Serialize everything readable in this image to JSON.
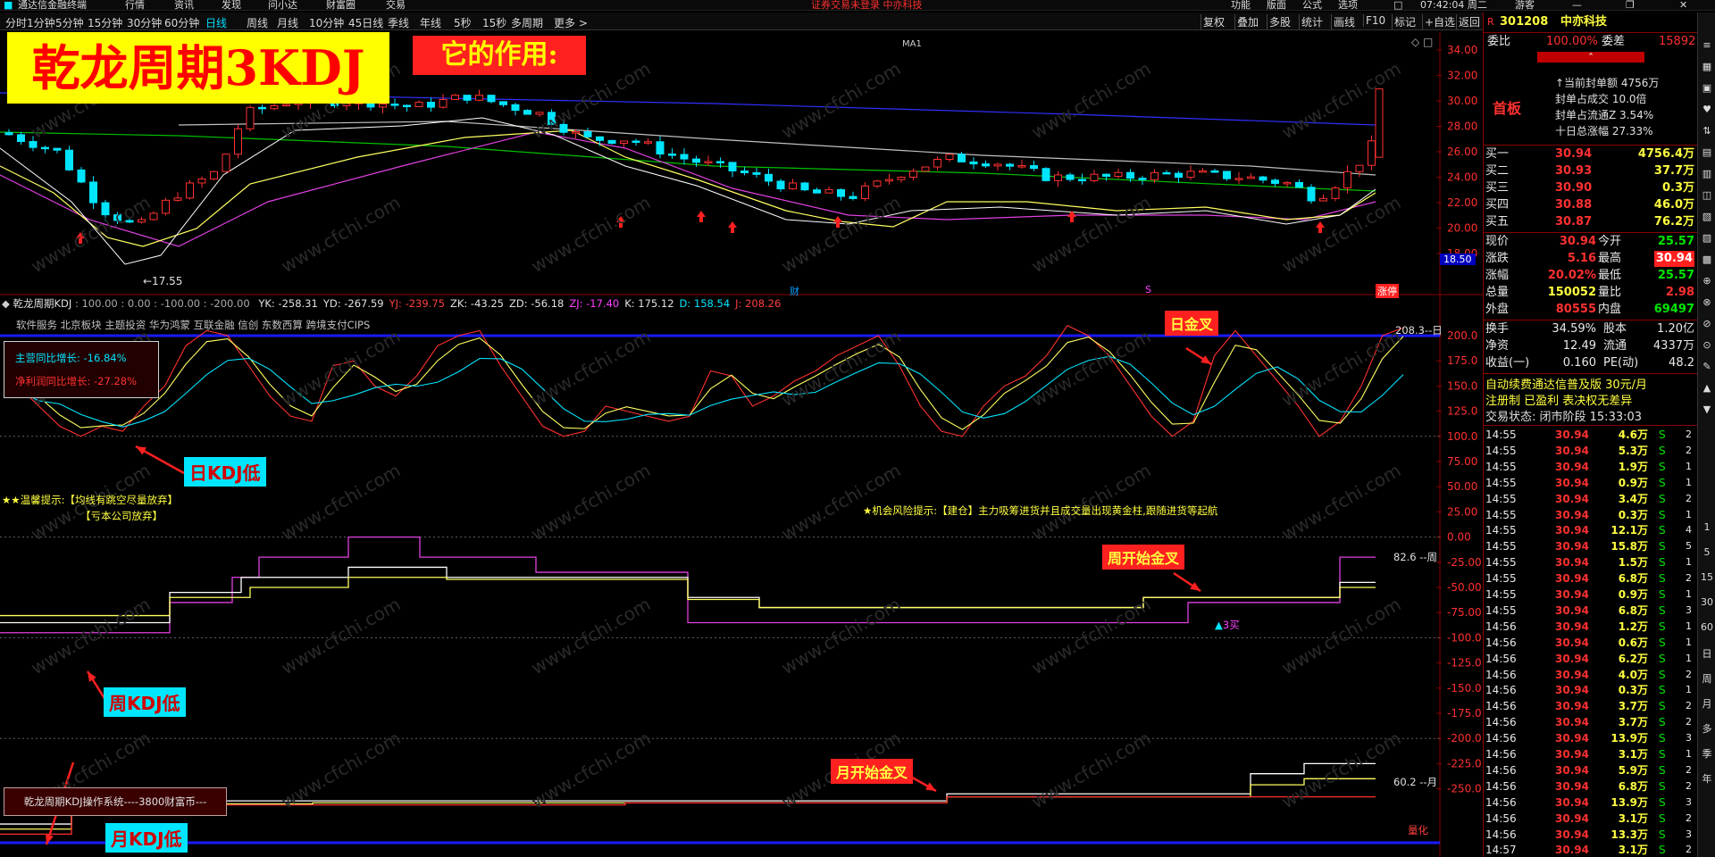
{
  "titlebar": {
    "app_name": "通达信金融终端",
    "menus": [
      "行情",
      "资讯",
      "发现",
      "问小达",
      "财富圈",
      "交易"
    ],
    "notice": "证券交易未登录  中亦科技",
    "right_menus": [
      "功能",
      "版面",
      "公式",
      "选项"
    ],
    "time": "07:42:04 周二",
    "login": "游客"
  },
  "periods": [
    "分时",
    "1分钟",
    "5分钟",
    "15分钟",
    "30分钟",
    "60分钟",
    "日线",
    "周线",
    "月线",
    "10分钟",
    "45日线",
    "季线",
    "年线",
    "5秒",
    "15秒",
    "多周期",
    "更多 >"
  ],
  "active_period": "日线",
  "tools": [
    "复权",
    "叠加",
    "多股",
    "统计",
    "画线",
    "F10",
    "标记",
    "+自选",
    "返回"
  ],
  "banner": {
    "title": "乾龙周期3KDJ",
    "subtitle": "它的作用:"
  },
  "price_axis": [
    "34.00",
    "32.00",
    "30.00",
    "28.00",
    "26.00",
    "24.00",
    "22.00",
    "20.00",
    "18.00"
  ],
  "price_marker": "18.50",
  "low_label": "←17.55",
  "bottom_marks": {
    "cai": "财",
    "s": "S",
    "zhangting": "涨停"
  },
  "ma_label": "MA1",
  "indicator": {
    "name": "乾龙周期KDJ",
    "params": ": 100.00 : 0.00 : -100.00 : -200.00",
    "vals": [
      {
        "t": "YK: -258.31",
        "c": "#e0e0e0"
      },
      {
        "t": "YD: -267.59",
        "c": "#e0e0e0"
      },
      {
        "t": "YJ: -239.75",
        "c": "#ff4040"
      },
      {
        "t": "ZK: -43.25",
        "c": "#e0e0e0"
      },
      {
        "t": "ZD: -56.18",
        "c": "#e0e0e0"
      },
      {
        "t": "ZJ: -17.40",
        "c": "#ff40ff"
      },
      {
        "t": "K: 175.12",
        "c": "#e0e0e0"
      },
      {
        "t": "D: 158.54",
        "c": "#00e5ff"
      },
      {
        "t": "J: 208.26",
        "c": "#ff4040"
      }
    ],
    "concepts": "软件服务 北京板块 主题投资 华为鸿蒙 互联金融 信创 东数西算 跨境支付CIPS",
    "growth": [
      "主营同比增长: -16.84%",
      "净利润同比增长: -27.28%"
    ],
    "tip1": "★★温馨提示:【均线有跳空尽量放弃】",
    "tip2": "【亏本公司放弃】",
    "tip3": "★机会风险提示:【建仓】主力吸筹进货并且成交量出现黄金柱,跟随进货等起航",
    "day_label": "208.3--日",
    "week_label": "82.6  --周",
    "month_label": "60.2  --月",
    "buy3": "3买",
    "quant": "量化",
    "system_box": "乾龙周期KDJ操作系统----3800财富币---"
  },
  "ind_axis": [
    "200.0",
    "175.0",
    "150.0",
    "125.0",
    "100.0",
    "75.00",
    "50.00",
    "25.00",
    "0.00",
    "-25.00",
    "-50.00",
    "-75.00",
    "-100.0",
    "-125.0",
    "-150.0",
    "-175.0",
    "-200.0",
    "-225.0",
    "-250.0"
  ],
  "annotations": {
    "day_gold": "日金叉",
    "day_low": "日KDJ低",
    "week_gold": "周开始金叉",
    "week_low": "周KDJ低",
    "month_gold": "月开始金叉",
    "month_low": "月KDJ低"
  },
  "quote": {
    "code": "301208",
    "name": "中亦科技",
    "weibi_label": "委比",
    "weibi": "100.00%",
    "weicha_label": "委差",
    "weicha": "15892",
    "shouban": "首板",
    "limit_info": [
      "↑当前封单额  4756万",
      "封单占成交  10.0倍",
      "封单占流通Z  3.54%",
      "十日总涨幅  27.33%"
    ],
    "bids": [
      {
        "label": "买一",
        "price": "30.94",
        "vol": "4756.4万"
      },
      {
        "label": "买二",
        "price": "30.93",
        "vol": "37.7万"
      },
      {
        "label": "买三",
        "price": "30.90",
        "vol": "0.3万"
      },
      {
        "label": "买四",
        "price": "30.88",
        "vol": "46.0万"
      },
      {
        "label": "买五",
        "price": "30.87",
        "vol": "76.2万"
      }
    ],
    "stats": [
      {
        "l1": "现价",
        "v1": "30.94",
        "c1": "red",
        "l2": "今开",
        "v2": "25.57",
        "c2": "grn"
      },
      {
        "l1": "涨跌",
        "v1": "5.16",
        "c1": "red",
        "l2": "最高",
        "v2": "30.94",
        "c2": "redbg"
      },
      {
        "l1": "涨幅",
        "v1": "20.02%",
        "c1": "red",
        "l2": "最低",
        "v2": "25.57",
        "c2": "grn"
      },
      {
        "l1": "总量",
        "v1": "150052",
        "c1": "yel",
        "l2": "量比",
        "v2": "2.98",
        "c2": "red"
      },
      {
        "l1": "外盘",
        "v1": "80555",
        "c1": "red",
        "l2": "内盘",
        "v2": "69497",
        "c2": "grn"
      }
    ],
    "stats2": [
      {
        "l1": "换手",
        "v1": "34.59%",
        "l2": "股本",
        "v2": "1.20亿"
      },
      {
        "l1": "净资",
        "v1": "12.49",
        "l2": "流通",
        "v2": "4337万"
      },
      {
        "l1": "收益(一)",
        "v1": "0.160",
        "l2": "PE(动)",
        "v2": "48.2"
      }
    ],
    "promo1": "自动续费通达信普及版  30元/月",
    "promo2": "注册制 已盈利 表决权无差异",
    "status": "交易状态: 闭市阶段  15:33:03",
    "ticks": [
      {
        "t": "14:55",
        "p": "30.94",
        "v": "4.6万",
        "s": "S",
        "n": "2"
      },
      {
        "t": "14:55",
        "p": "30.94",
        "v": "5.3万",
        "s": "S",
        "n": "2"
      },
      {
        "t": "14:55",
        "p": "30.94",
        "v": "1.9万",
        "s": "S",
        "n": "1"
      },
      {
        "t": "14:55",
        "p": "30.94",
        "v": "0.9万",
        "s": "S",
        "n": "1"
      },
      {
        "t": "14:55",
        "p": "30.94",
        "v": "3.4万",
        "s": "S",
        "n": "2"
      },
      {
        "t": "14:55",
        "p": "30.94",
        "v": "0.3万",
        "s": "S",
        "n": "1"
      },
      {
        "t": "14:55",
        "p": "30.94",
        "v": "12.1万",
        "s": "S",
        "n": "4"
      },
      {
        "t": "14:55",
        "p": "30.94",
        "v": "15.8万",
        "s": "S",
        "n": "5"
      },
      {
        "t": "14:55",
        "p": "30.94",
        "v": "1.5万",
        "s": "S",
        "n": "1"
      },
      {
        "t": "14:55",
        "p": "30.94",
        "v": "6.8万",
        "s": "S",
        "n": "2"
      },
      {
        "t": "14:55",
        "p": "30.94",
        "v": "0.9万",
        "s": "S",
        "n": "1"
      },
      {
        "t": "14:55",
        "p": "30.94",
        "v": "6.8万",
        "s": "S",
        "n": "3"
      },
      {
        "t": "14:56",
        "p": "30.94",
        "v": "1.2万",
        "s": "S",
        "n": "1"
      },
      {
        "t": "14:56",
        "p": "30.94",
        "v": "0.6万",
        "s": "S",
        "n": "1"
      },
      {
        "t": "14:56",
        "p": "30.94",
        "v": "6.2万",
        "s": "S",
        "n": "1"
      },
      {
        "t": "14:56",
        "p": "30.94",
        "v": "4.0万",
        "s": "S",
        "n": "2"
      },
      {
        "t": "14:56",
        "p": "30.94",
        "v": "0.3万",
        "s": "S",
        "n": "1"
      },
      {
        "t": "14:56",
        "p": "30.94",
        "v": "3.7万",
        "s": "S",
        "n": "2"
      },
      {
        "t": "14:56",
        "p": "30.94",
        "v": "3.7万",
        "s": "S",
        "n": "2"
      },
      {
        "t": "14:56",
        "p": "30.94",
        "v": "13.9万",
        "s": "S",
        "n": "3"
      },
      {
        "t": "14:56",
        "p": "30.94",
        "v": "3.1万",
        "s": "S",
        "n": "1"
      },
      {
        "t": "14:56",
        "p": "30.94",
        "v": "5.9万",
        "s": "S",
        "n": "2"
      },
      {
        "t": "14:56",
        "p": "30.94",
        "v": "6.8万",
        "s": "S",
        "n": "2"
      },
      {
        "t": "14:56",
        "p": "30.94",
        "v": "13.9万",
        "s": "S",
        "n": "3"
      },
      {
        "t": "14:56",
        "p": "30.94",
        "v": "3.1万",
        "s": "S",
        "n": "2"
      },
      {
        "t": "14:56",
        "p": "30.94",
        "v": "13.3万",
        "s": "S",
        "n": "3"
      },
      {
        "t": "14:57",
        "p": "30.94",
        "v": "3.1万",
        "s": "S",
        "n": "2"
      }
    ]
  },
  "sidebar": [
    "1",
    "5",
    "15",
    "30",
    "60",
    "日",
    "周",
    "月",
    "多",
    "季",
    "年"
  ],
  "colors": {
    "up": "#ff3030",
    "down": "#00e5ff",
    "grid": "#8b0000",
    "blue_line": "#1a1aff"
  }
}
